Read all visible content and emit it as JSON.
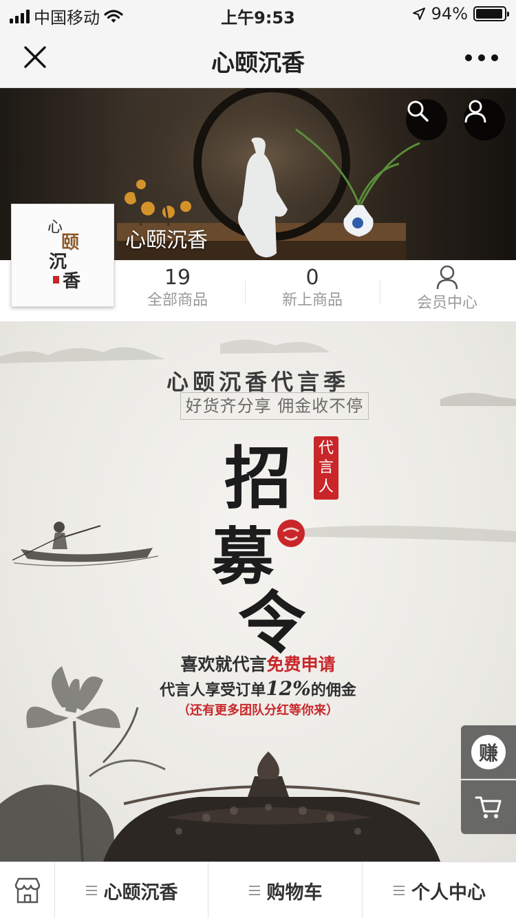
{
  "status_bar": {
    "carrier": "中国移动",
    "time": "上午9:53",
    "battery": "94%",
    "battery_level": 0.94,
    "icons": [
      "signal-icon",
      "wifi-icon",
      "location-arrow-icon",
      "battery-icon"
    ]
  },
  "nav": {
    "title": "心颐沉香",
    "close_icon": "close-icon",
    "more_icon": "more-icon"
  },
  "shop": {
    "name": "心颐沉香",
    "logo_text": "心颐沉香",
    "stats": [
      {
        "value": "19",
        "label": "全部商品"
      },
      {
        "value": "0",
        "label": "新上商品"
      },
      {
        "icon": "user-icon",
        "label": "会员中心"
      }
    ]
  },
  "banner": {
    "title": "心颐沉香代言季",
    "subtitle": "好货齐分享 佣金收不停",
    "big_chars": [
      "招",
      "募",
      "令"
    ],
    "seal_text": "代言人",
    "line1_prefix": "喜欢就代言",
    "line1_red": "免费申请",
    "line2_prefix": "代言人享受订单",
    "line2_pct": "12%",
    "line2_suffix": "的佣金",
    "line3": "（还有更多团队分红等你来）"
  },
  "float_buttons": {
    "earn_label": "赚",
    "cart_icon": "cart-icon"
  },
  "tabbar": {
    "home_icon": "shop-icon",
    "tabs": [
      {
        "label": "心颐沉香"
      },
      {
        "label": "购物车"
      },
      {
        "label": "个人中心"
      }
    ]
  },
  "colors": {
    "accent_red": "#c9262a",
    "bar_bg": "#f5f5f5"
  }
}
